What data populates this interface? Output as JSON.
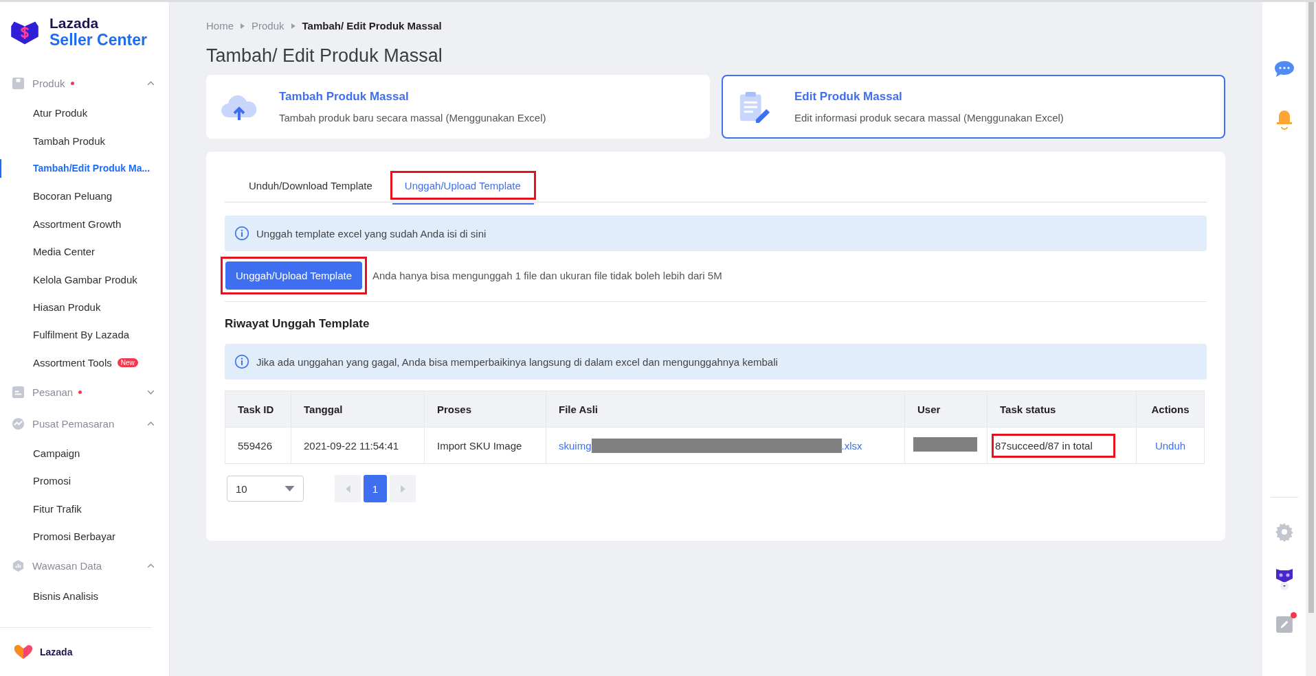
{
  "brand": {
    "name": "Lazada",
    "subtitle": "Seller Center"
  },
  "sidebar": {
    "groups": [
      {
        "label": "Produk",
        "dot": true,
        "expanded": true,
        "items": [
          {
            "label": "Atur Produk",
            "selected": false
          },
          {
            "label": "Tambah Produk",
            "selected": false
          },
          {
            "label": "Tambah/Edit Produk Ma...",
            "selected": true
          },
          {
            "label": "Bocoran Peluang",
            "selected": false
          },
          {
            "label": "Assortment Growth",
            "selected": false
          },
          {
            "label": "Media Center",
            "selected": false
          },
          {
            "label": "Kelola Gambar Produk",
            "selected": false
          },
          {
            "label": "Hiasan Produk",
            "selected": false
          },
          {
            "label": "Fulfilment By Lazada",
            "selected": false
          },
          {
            "label": "Assortment Tools",
            "selected": false,
            "badge": "New"
          }
        ]
      },
      {
        "label": "Pesanan",
        "dot": true,
        "expanded": false
      },
      {
        "label": "Pusat Pemasaran",
        "dot": false,
        "expanded": true,
        "items": [
          {
            "label": "Campaign",
            "selected": false
          },
          {
            "label": "Promosi",
            "selected": false
          },
          {
            "label": "Fitur Trafik",
            "selected": false
          },
          {
            "label": "Promosi Berbayar",
            "selected": false
          }
        ]
      },
      {
        "label": "Wawasan Data",
        "dot": false,
        "expanded": true,
        "items": [
          {
            "label": "Bisnis Analisis",
            "selected": false
          }
        ]
      }
    ],
    "footer": "Lazada"
  },
  "breadcrumb": [
    "Home",
    "Produk",
    "Tambah/ Edit Produk Massal"
  ],
  "page_title": "Tambah/ Edit Produk Massal",
  "cards": [
    {
      "title": "Tambah Produk Massal",
      "description": "Tambah produk baru secara massal (Menggunakan Excel)",
      "selected": false
    },
    {
      "title": "Edit Produk Massal",
      "description": "Edit informasi produk secara massal (Menggunakan Excel)",
      "selected": true
    }
  ],
  "tabs": [
    {
      "label": "Unduh/Download Template",
      "selected": false,
      "highlighted": false
    },
    {
      "label": "Unggah/Upload Template",
      "selected": true,
      "highlighted": true
    }
  ],
  "upload_info": "Unggah template excel yang sudah Anda isi di sini",
  "upload_button": {
    "label": "Unggah/Upload Template",
    "highlighted": true
  },
  "upload_hint": "Anda hanya bisa mengunggah 1 file dan ukuran file tidak boleh lebih dari 5M",
  "history_title": "Riwayat Unggah Template",
  "history_info": "Jika ada unggahan yang gagal, Anda bisa memperbaikinya langsung di dalam excel dan mengunggahnya kembali",
  "table": {
    "columns": [
      "Task ID",
      "Tanggal",
      "Proses",
      "File Asli",
      "User",
      "Task status",
      "Actions"
    ],
    "rows": [
      {
        "task_id": "559426",
        "date": "2021-09-22 11:54:41",
        "process": "Import SKU Image",
        "file_prefix": "skuimg",
        "file_redacted": true,
        "file_suffix": ".xlsx",
        "user_redacted": true,
        "status": "87succeed/87 in total",
        "status_highlighted": true,
        "action": "Unduh"
      }
    ]
  },
  "pagination": {
    "page_size": "10",
    "prev_disabled": true,
    "next_disabled": true,
    "pages": [
      {
        "label": "1",
        "selected": true
      }
    ]
  },
  "right_rail": {
    "notes_badge": true
  }
}
